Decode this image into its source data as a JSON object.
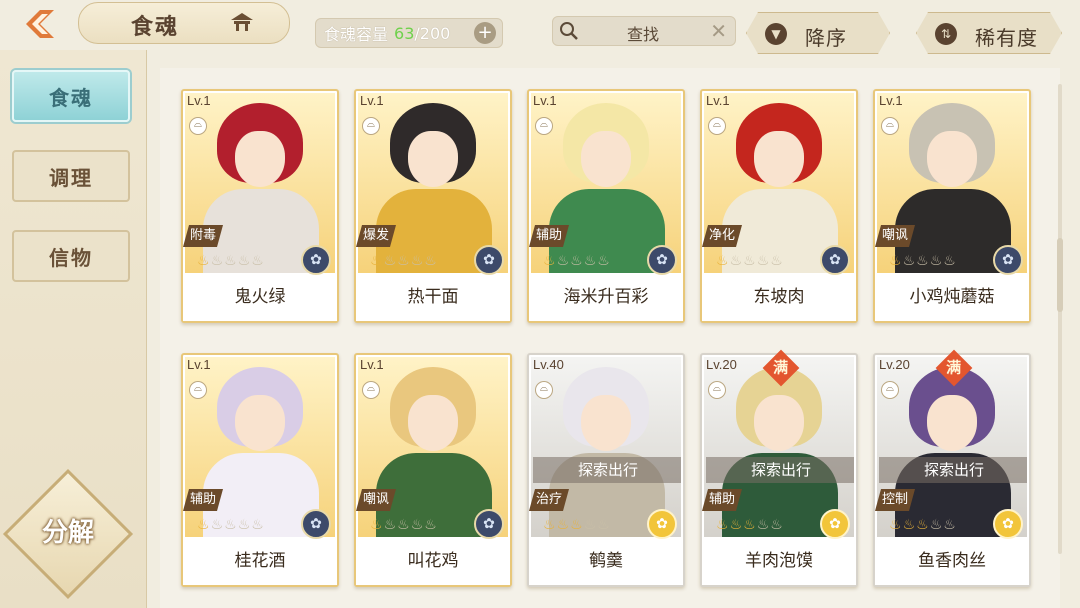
{
  "header": {
    "title": "食魂",
    "capacity_label": "食魂容量",
    "capacity_count": "63",
    "capacity_total": "/200",
    "add_symbol": "+",
    "search_label": "查找",
    "sort_order_label": "降序",
    "sort_type_label": "稀有度"
  },
  "sidebar": {
    "tabs": [
      {
        "label": "食魂"
      },
      {
        "label": "调理"
      },
      {
        "label": "信物"
      }
    ],
    "decompose_label": "分解"
  },
  "cards": [
    {
      "level": "Lv.1",
      "role": "附毒",
      "name": "鬼火绿",
      "stars_filled": 1,
      "stars_total": 5,
      "element_icon": "moon-flower-icon",
      "hair": "#b21f2d",
      "outfit": "#e7e1da"
    },
    {
      "level": "Lv.1",
      "role": "爆发",
      "name": "热干面",
      "stars_filled": 1,
      "stars_total": 5,
      "element_icon": "moon-flower-icon",
      "hair": "#2f2a2a",
      "outfit": "#e3b23c"
    },
    {
      "level": "Lv.1",
      "role": "辅助",
      "name": "海米升百彩",
      "stars_filled": 1,
      "stars_total": 5,
      "element_icon": "moon-flower-icon",
      "hair": "#f4e7a6",
      "outfit": "#3f8a4f"
    },
    {
      "level": "Lv.1",
      "role": "净化",
      "name": "东坡肉",
      "stars_filled": 1,
      "stars_total": 5,
      "element_icon": "moon-flower-icon",
      "hair": "#c4261e",
      "outfit": "#f0ead8"
    },
    {
      "level": "Lv.1",
      "role": "嘲讽",
      "name": "小鸡炖蘑菇",
      "stars_filled": 1,
      "stars_total": 5,
      "element_icon": "moon-flower-icon",
      "hair": "#c8c2b3",
      "outfit": "#2d2b2a"
    },
    {
      "level": "Lv.1",
      "role": "辅助",
      "name": "桂花酒",
      "stars_filled": 1,
      "stars_total": 5,
      "element_icon": "moon-flower-icon",
      "hair": "#d9cde6",
      "outfit": "#f2eef6"
    },
    {
      "level": "Lv.1",
      "role": "嘲讽",
      "name": "叫花鸡",
      "stars_filled": 1,
      "stars_total": 5,
      "element_icon": "moon-flower-icon",
      "hair": "#e9c77e",
      "outfit": "#3e6e3a"
    },
    {
      "level": "Lv.40",
      "role": "治疗",
      "name": "鹌羹",
      "stars_filled": 3,
      "stars_total": 5,
      "element_icon": "sun-flower-icon",
      "explore": "探索出行",
      "hair": "#e9e6ec",
      "outfit": "#c2b9a6"
    },
    {
      "level": "Lv.20",
      "role": "辅助",
      "name": "羊肉泡馍",
      "stars_filled": 3,
      "stars_total": 5,
      "element_icon": "sun-flower-icon",
      "explore": "探索出行",
      "max_badge": "满",
      "hair": "#e6d394",
      "outfit": "#2e5b3a"
    },
    {
      "level": "Lv.20",
      "role": "控制",
      "name": "鱼香肉丝",
      "stars_filled": 3,
      "stars_total": 5,
      "element_icon": "sun-flower-icon",
      "explore": "探索出行",
      "max_badge": "满",
      "hair": "#6a4f8e",
      "outfit": "#2a2a33"
    }
  ]
}
